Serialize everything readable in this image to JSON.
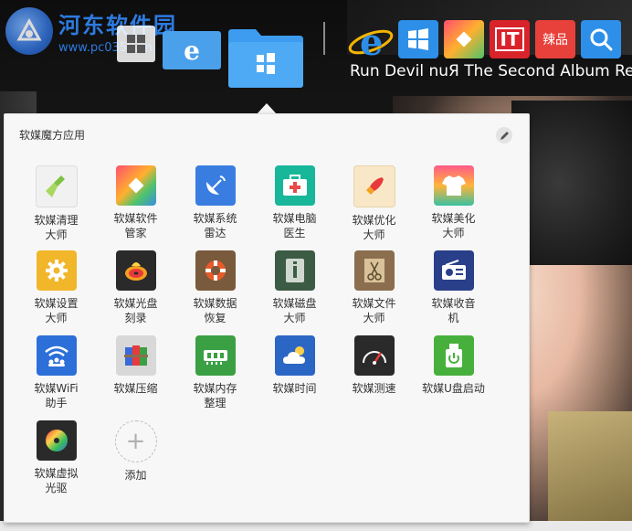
{
  "watermark": {
    "title": "河东软件园",
    "url": "www.pc0359.cn"
  },
  "album_text": "Run Devil nuЯ The Second Album Re",
  "panel": {
    "title": "软媒魔方应用",
    "edit_icon": "pencil-icon"
  },
  "apps": [
    {
      "label": "软媒清理大师",
      "icon": "broom-icon",
      "color": "#f1f1f1"
    },
    {
      "label": "软媒软件管家",
      "icon": "colorful-diamond-icon",
      "color": "#ff5a5a"
    },
    {
      "label": "软媒系统雷达",
      "icon": "satellite-dish-icon",
      "color": "#3a7de0"
    },
    {
      "label": "软媒电脑医生",
      "icon": "first-aid-kit-icon",
      "color": "#18b79a"
    },
    {
      "label": "软媒优化大师",
      "icon": "rocket-icon",
      "color": "#f8e8c8"
    },
    {
      "label": "软媒美化大师",
      "icon": "tshirt-icon",
      "color": "#ff6aa2"
    },
    {
      "label": "软媒设置大师",
      "icon": "gear-icon",
      "color": "#f1b62a"
    },
    {
      "label": "软媒光盘刻录",
      "icon": "burning-disc-icon",
      "color": "#2a2a2a"
    },
    {
      "label": "软媒数据恢复",
      "icon": "lifebuoy-icon",
      "color": "#7a5a3d"
    },
    {
      "label": "软媒磁盘大师",
      "icon": "disk-info-icon",
      "color": "#3c5b45"
    },
    {
      "label": "软媒文件大师",
      "icon": "envelope-scissors-icon",
      "color": "#8a6e4e"
    },
    {
      "label": "软媒收音机",
      "icon": "radio-icon",
      "color": "#2a3f8a"
    },
    {
      "label": "软媒WiFi助手",
      "icon": "wifi-icon",
      "color": "#2d6fd8"
    },
    {
      "label": "软媒压缩",
      "icon": "archive-books-icon",
      "color": "#d8d8d8"
    },
    {
      "label": "软媒内存整理",
      "icon": "memory-chip-icon",
      "color": "#3aa043"
    },
    {
      "label": "软媒时间",
      "icon": "weather-cloud-icon",
      "color": "#2c66c5"
    },
    {
      "label": "软媒测速",
      "icon": "speedometer-icon",
      "color": "#2a2a2a"
    },
    {
      "label": "软媒U盘启动",
      "icon": "usb-power-icon",
      "color": "#47b03c"
    },
    {
      "label": "软媒虚拟光驱",
      "icon": "virtual-disc-icon",
      "color": "#2a2a2a"
    },
    {
      "label": "添加",
      "icon": "plus-icon",
      "color": "#f7f7f7"
    }
  ],
  "taskbar": {
    "left_items": [
      "windows-start-icon",
      "edge-browser-icon",
      "folder-icon"
    ],
    "right_items": [
      "ie-browser-icon",
      "windows-tiles-icon",
      "diamond-app-icon",
      "ithome-icon",
      "lapin-icon",
      "search-icon"
    ],
    "ithome_label": "IT",
    "lapin_label": "辣品"
  }
}
